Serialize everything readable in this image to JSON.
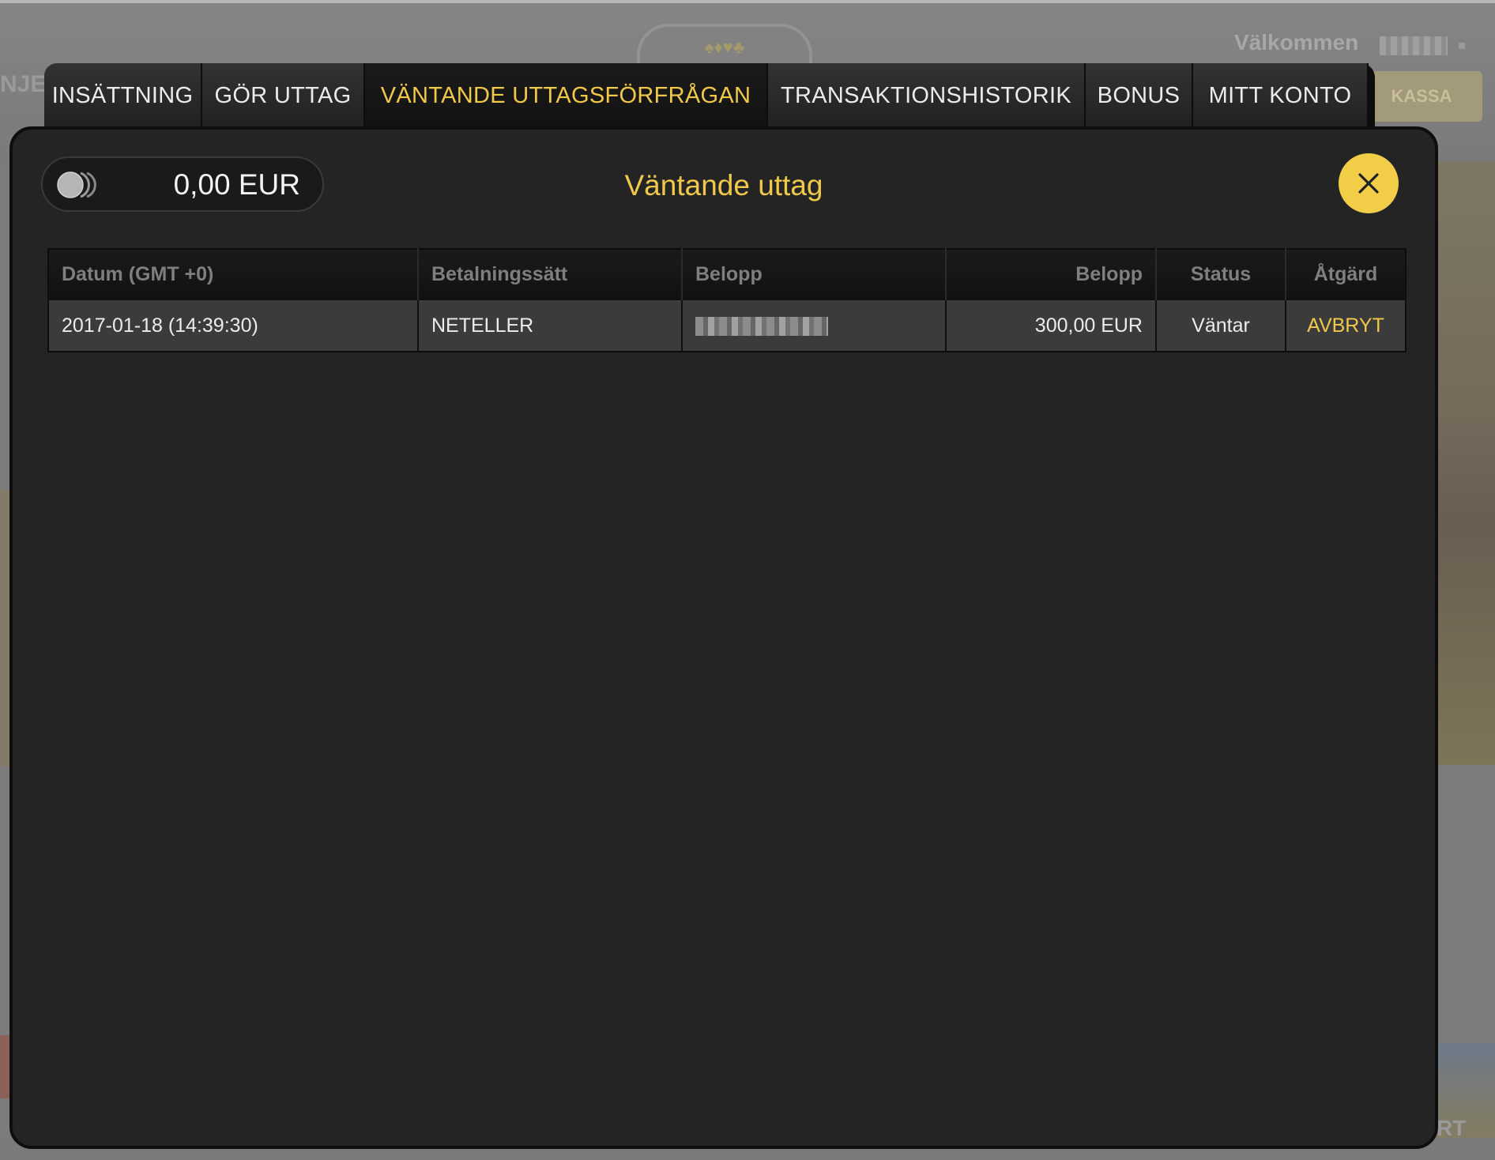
{
  "background": {
    "welcome_text": "Välkommen",
    "kassa_label": "KASSA",
    "left_partial_text": "NJER",
    "right_partial_text": "RT",
    "logo_symbols": "♠♦♥♣"
  },
  "tabs": [
    {
      "label": "INSÄTTNING",
      "active": false
    },
    {
      "label": "GÖR UTTAG",
      "active": false
    },
    {
      "label": "VÄNTANDE UTTAGSFÖRFRÅGAN",
      "active": true
    },
    {
      "label": "TRANSAKTIONSHISTORIK",
      "active": false
    },
    {
      "label": "BONUS",
      "active": false
    },
    {
      "label": "MITT KONTO",
      "active": false
    }
  ],
  "modal": {
    "balance": "0,00 EUR",
    "title": "Väntande uttag",
    "close_icon": "close-icon"
  },
  "table": {
    "headers": [
      "Datum (GMT +0)",
      "Betalningssätt",
      "Belopp",
      "Belopp",
      "Status",
      "Åtgärd"
    ],
    "rows": [
      {
        "date": "2017-01-18 (14:39:30)",
        "method": "NETELLER",
        "account": "",
        "amount": "300,00 EUR",
        "status": "Väntar",
        "action": "AVBRYT"
      }
    ]
  },
  "colors": {
    "accent": "#f0c94a",
    "modal_bg": "#242424",
    "row_bg": "#3b3b3b",
    "header_text": "#7f7f7f"
  }
}
